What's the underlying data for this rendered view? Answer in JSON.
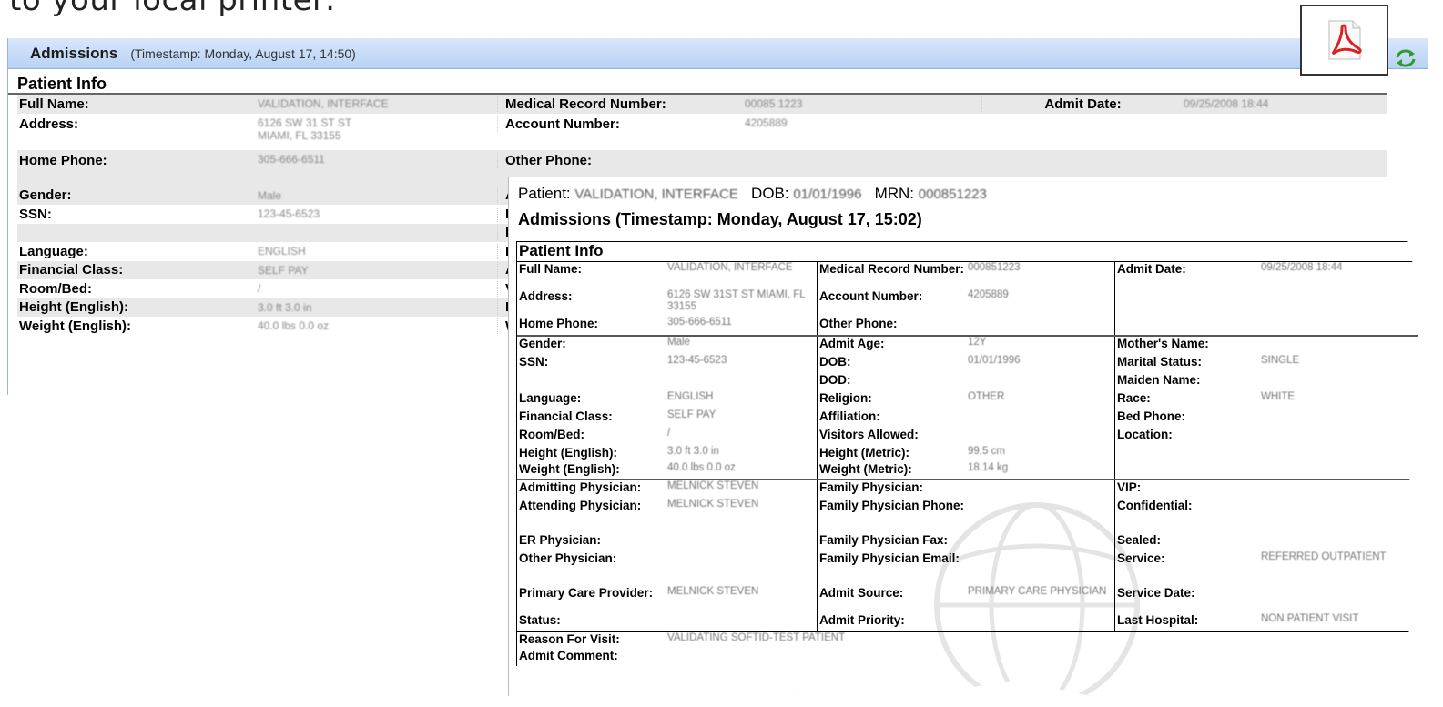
{
  "caption": "to your local printer:",
  "back": {
    "title": "Admissions",
    "timestamp": "(Timestamp: Monday, August 17, 14:50)",
    "section": "Patient Info",
    "rows": [
      {
        "l1": "Full Name:",
        "v1": "VALIDATION, INTERFACE",
        "l2": "Medical Record Number:",
        "v2": "00085 1223",
        "l3": "Admit Date:",
        "v3": "09/25/2008 18:44",
        "tall": false,
        "alt": true
      },
      {
        "l1": "Address:",
        "v1": "6126 SW 31 ST ST\nMIAMI, FL 33155",
        "l2": "Account Number:",
        "v2": "4205889",
        "l3": "",
        "v3": "",
        "tall": true,
        "alt": false
      },
      {
        "l1": "Home Phone:",
        "v1": "305-666-6511",
        "l2": "Other Phone:",
        "v2": "",
        "l3": "",
        "v3": "",
        "tall": true,
        "alt": true
      },
      {
        "l1": "Gender:",
        "v1": "Male",
        "l2": "A",
        "v2": "",
        "l3": "",
        "v3": "",
        "tall": false,
        "alt": true
      },
      {
        "l1": "SSN:",
        "v1": "123-45-6523",
        "l2": "D",
        "v2": "",
        "l3": "",
        "v3": "",
        "tall": false,
        "alt": false
      },
      {
        "l1": "",
        "v1": "",
        "l2": "D",
        "v2": "",
        "l3": "",
        "v3": "",
        "tall": false,
        "alt": true
      },
      {
        "l1": "Language:",
        "v1": "ENGLISH",
        "l2": "R",
        "v2": "",
        "l3": "",
        "v3": "",
        "tall": false,
        "alt": false
      },
      {
        "l1": "Financial Class:",
        "v1": "SELF PAY",
        "l2": "A",
        "v2": "",
        "l3": "",
        "v3": "",
        "tall": false,
        "alt": true
      },
      {
        "l1": "Room/Bed:",
        "v1": "/",
        "l2": "V",
        "v2": "",
        "l3": "",
        "v3": "",
        "tall": false,
        "alt": false
      },
      {
        "l1": "Height (English):",
        "v1": "3.0 ft 3.0 in",
        "l2": "H",
        "v2": "",
        "l3": "",
        "v3": "",
        "tall": false,
        "alt": true
      },
      {
        "l1": "Weight (English):",
        "v1": "40.0 lbs 0.0 oz",
        "l2": "W",
        "v2": "",
        "l3": "",
        "v3": "",
        "tall": false,
        "alt": false
      }
    ]
  },
  "icons": {
    "pdf": "pdf-icon",
    "refresh": "refresh-icon"
  },
  "front": {
    "patient_label": "Patient:",
    "patient_name": "VALIDATION, INTERFACE",
    "dob_label": "DOB:",
    "dob": "01/01/1996",
    "mrn_label": "MRN:",
    "mrn": "000851223",
    "title": "Admissions (Timestamp: Monday, August 17, 15:02)",
    "section": "Patient Info",
    "block1": {
      "a": [
        {
          "l": "Full Name:",
          "v": "VALIDATION, INTERFACE",
          "h": 30
        },
        {
          "l": "Address:",
          "v": "6126 SW 31ST ST MIAMI, FL 33155",
          "h": 30
        },
        {
          "l": "Home Phone:",
          "v": "305-666-6511",
          "h": 20
        }
      ],
      "b": [
        {
          "l": "Medical Record Number:",
          "v": "000851223",
          "h": 30
        },
        {
          "l": "Account Number:",
          "v": "4205889",
          "h": 30
        },
        {
          "l": "Other Phone:",
          "v": "",
          "h": 20
        }
      ],
      "c": [
        {
          "l": "Admit Date:",
          "v": "09/25/2008 18:44",
          "h": 30
        },
        {
          "l": "",
          "v": "",
          "h": 30
        },
        {
          "l": "",
          "v": "",
          "h": 20
        }
      ]
    },
    "block2": {
      "a": [
        {
          "l": "Gender:",
          "v": "Male",
          "h": 20
        },
        {
          "l": "SSN:",
          "v": "123-45-6523",
          "h": 20
        },
        {
          "l": "",
          "v": "",
          "h": 20
        },
        {
          "l": "Language:",
          "v": "ENGLISH",
          "h": 20
        },
        {
          "l": "Financial Class:",
          "v": "SELF PAY",
          "h": 20
        },
        {
          "l": "Room/Bed:",
          "v": "/",
          "h": 20
        },
        {
          "l": "Height (English):",
          "v": "3.0 ft 3.0 in",
          "h": 18
        },
        {
          "l": "Weight (English):",
          "v": "40.0 lbs 0.0 oz",
          "h": 18
        }
      ],
      "b": [
        {
          "l": "Admit Age:",
          "v": "12Y",
          "h": 20
        },
        {
          "l": "DOB:",
          "v": "01/01/1996",
          "h": 20
        },
        {
          "l": "DOD:",
          "v": "",
          "h": 20
        },
        {
          "l": "Religion:",
          "v": "OTHER",
          "h": 20
        },
        {
          "l": "Affiliation:",
          "v": "",
          "h": 20
        },
        {
          "l": "Visitors Allowed:",
          "v": "",
          "h": 20
        },
        {
          "l": "Height (Metric):",
          "v": "99.5 cm",
          "h": 18
        },
        {
          "l": "Weight (Metric):",
          "v": "18.14 kg",
          "h": 18
        }
      ],
      "c": [
        {
          "l": "Mother's Name:",
          "v": "",
          "h": 20
        },
        {
          "l": "Marital Status:",
          "v": "SINGLE",
          "h": 20
        },
        {
          "l": "Maiden Name:",
          "v": "",
          "h": 20
        },
        {
          "l": "Race:",
          "v": "WHITE",
          "h": 20
        },
        {
          "l": "Bed Phone:",
          "v": "",
          "h": 20
        },
        {
          "l": "Location:",
          "v": "",
          "h": 20
        },
        {
          "l": "",
          "v": "",
          "h": 18
        },
        {
          "l": "",
          "v": "",
          "h": 18
        }
      ]
    },
    "block3": {
      "a": [
        {
          "l": "Admitting Physician:",
          "v": "MELNICK STEVEN",
          "h": 20
        },
        {
          "l": "Attending Physician:",
          "v": "MELNICK STEVEN",
          "h": 38
        },
        {
          "l": "ER Physician:",
          "v": "",
          "h": 20
        },
        {
          "l": "Other Physician:",
          "v": "",
          "h": 38
        },
        {
          "l": "Primary Care Provider:",
          "v": "MELNICK STEVEN",
          "h": 30
        },
        {
          "l": "Status:",
          "v": "",
          "h": 20
        }
      ],
      "b": [
        {
          "l": "Family Physician:",
          "v": "",
          "h": 20
        },
        {
          "l": "Family Physician Phone:",
          "v": "",
          "h": 38
        },
        {
          "l": "Family Physician Fax:",
          "v": "",
          "h": 20
        },
        {
          "l": "Family Physician Email:",
          "v": "",
          "h": 38
        },
        {
          "l": "Admit Source:",
          "v": "PRIMARY CARE PHYSICIAN",
          "h": 30
        },
        {
          "l": "Admit Priority:",
          "v": "",
          "h": 20
        }
      ],
      "c": [
        {
          "l": "VIP:",
          "v": "",
          "h": 20
        },
        {
          "l": "Confidential:",
          "v": "",
          "h": 38
        },
        {
          "l": "Sealed:",
          "v": "",
          "h": 20
        },
        {
          "l": "Service:",
          "v": "REFERRED OUTPATIENT",
          "h": 38
        },
        {
          "l": "Service Date:",
          "v": "",
          "h": 30
        },
        {
          "l": "Last Hospital:",
          "v": "NON PATIENT VISIT",
          "h": 20
        }
      ]
    },
    "reason_label": "Reason For Visit:",
    "reason": "VALIDATING SOFTID-TEST PATIENT",
    "comment_label": "Admit Comment:",
    "comment": ""
  }
}
